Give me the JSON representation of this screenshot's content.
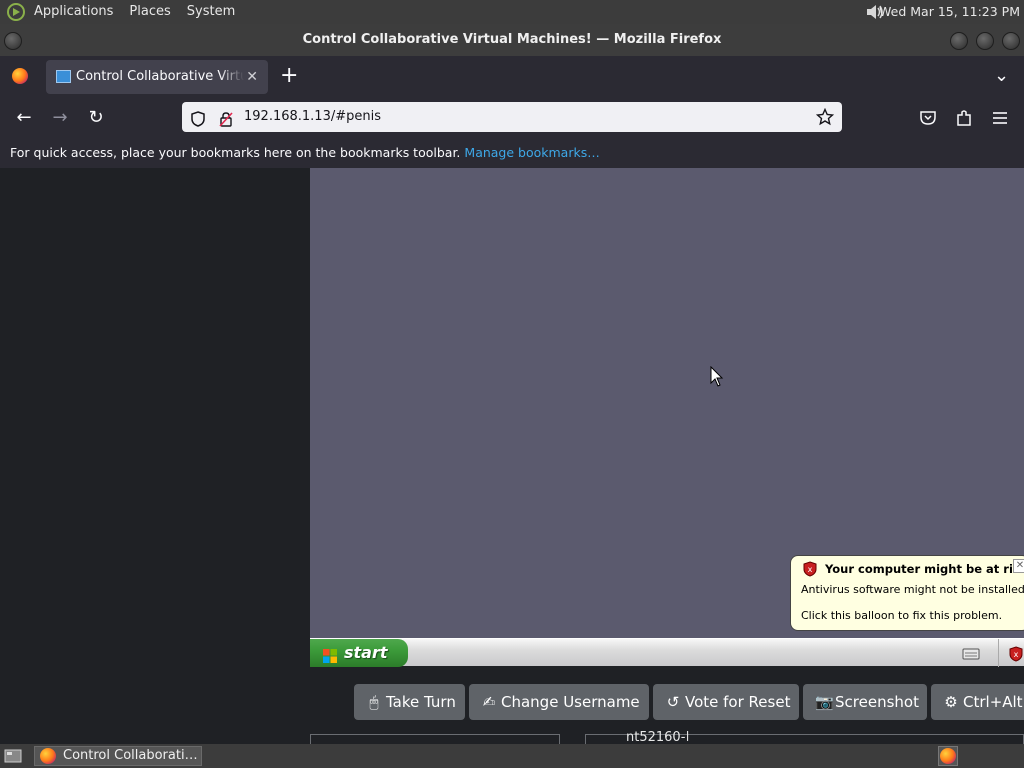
{
  "top_panel": {
    "menus": [
      "Applications",
      "Places",
      "System"
    ],
    "clock": "Wed Mar 15, 11:23 PM"
  },
  "window": {
    "title": "Control Collaborative Virtual Machines! — Mozilla Firefox"
  },
  "tabs": [
    {
      "label": "Control Collaborative Virtual Machines!",
      "close": "✕"
    }
  ],
  "new_tab": "+",
  "tab_list": "⌄",
  "nav": {
    "back": "←",
    "forward": "→",
    "reload": "↻",
    "url": "192.168.1.13/#penis"
  },
  "bookmarks": {
    "text": "For quick access, place your bookmarks here on the bookmarks toolbar.",
    "link": "Manage bookmarks…"
  },
  "vm": {
    "start_label": "start",
    "balloon": {
      "title": "Your computer might be at risk",
      "line1": "Antivirus software might not be installed",
      "line2": "Click this balloon to fix this problem.",
      "close": "✕"
    }
  },
  "controls": [
    {
      "label": "Take Turn",
      "icon": "mouse-icon",
      "glyph": "🖱"
    },
    {
      "label": "Change Username",
      "icon": "signature-icon",
      "glyph": "✍"
    },
    {
      "label": "Vote for Reset",
      "icon": "undo-icon",
      "glyph": "↺"
    },
    {
      "label": "Screenshot",
      "icon": "camera-icon",
      "glyph": "📷"
    },
    {
      "label": "Ctrl+Alt+",
      "icon": "gear-icon",
      "glyph": "⚙"
    }
  ],
  "partial_text": "nt52160-|",
  "taskbar": {
    "item": "Control Collaborati…"
  },
  "colors": {
    "link": "#3ea8e8",
    "vm_desktop": "#5b5a6e",
    "button_bg": "#5f6368"
  }
}
